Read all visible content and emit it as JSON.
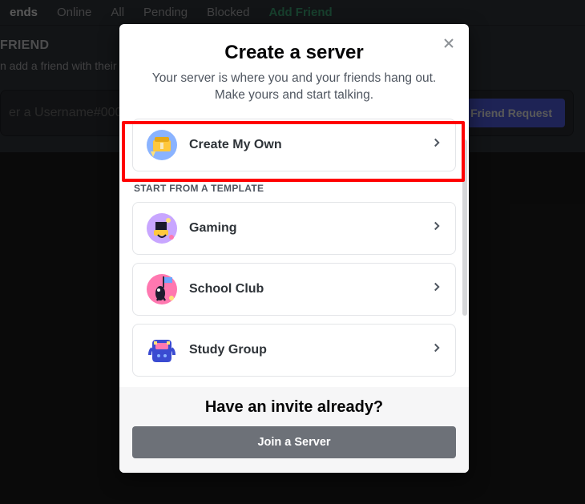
{
  "background": {
    "tabs": {
      "friends": "ends",
      "online": "Online",
      "all": "All",
      "pending": "Pending",
      "blocked": "Blocked",
      "add_friend": "Add Friend"
    },
    "friend_title": "FRIEND",
    "friend_sub": "n add a friend with their I",
    "input_placeholder": "er a Username#000",
    "send_button": "d Friend Request"
  },
  "modal": {
    "title": "Create a server",
    "subtitle": "Your server is where you and your friends hang out. Make yours and start talking.",
    "create_own": "Create My Own",
    "template_header": "START FROM A TEMPLATE",
    "templates": [
      {
        "label": "Gaming"
      },
      {
        "label": "School Club"
      },
      {
        "label": "Study Group"
      }
    ],
    "footer_title": "Have an invite already?",
    "join_button": "Join a Server"
  },
  "icons": {
    "close": "close-icon",
    "chevron": "chevron-right-icon",
    "create_own": "create-own-icon",
    "gaming": "gaming-icon",
    "school": "school-club-icon",
    "study": "study-group-icon"
  }
}
